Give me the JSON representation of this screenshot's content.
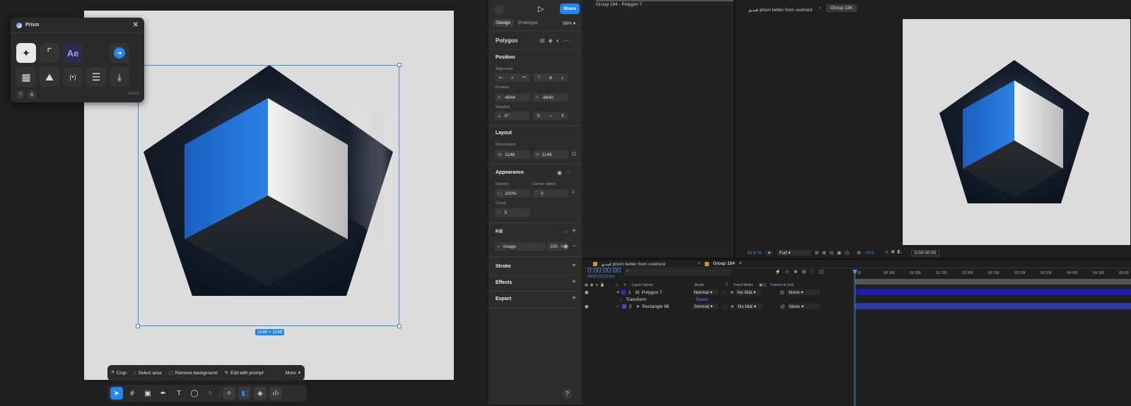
{
  "plugin": {
    "title": "Prism",
    "version": "v2.5.0",
    "ae_label": "Ae",
    "help": "?"
  },
  "canvas": {
    "size_badge": "1148 × 1148"
  },
  "context_bar": {
    "crop": "Crop",
    "select_area": "Select area",
    "remove_background": "Remove background",
    "edit_with_prompt": "Edit with prompt",
    "more": "More"
  },
  "main_toolbar": {
    "help": "?"
  },
  "header": {
    "share": "Share",
    "tabs": [
      "Design",
      "Prototype"
    ],
    "zoom": "58%"
  },
  "props": {
    "layer_name": "Polygon",
    "position_title": "Position",
    "alignment_label": "Alignment",
    "position_label": "Position",
    "x_prefix": "X",
    "x": "-4944",
    "y_prefix": "Y",
    "y": "-8840",
    "rotation_label": "Rotation",
    "rotation": "0°",
    "layout_title": "Layout",
    "dimensions_label": "Dimensions",
    "w_prefix": "W",
    "w": "1148",
    "h_prefix": "H",
    "h": "1148",
    "appearance_title": "Appearance",
    "opacity_label": "Opacity",
    "opacity": "100%",
    "corner_label": "Corner radius",
    "corner": "0",
    "count_label": "Count",
    "count": "5",
    "fill_title": "Fill",
    "fill_type": "Image",
    "fill_opacity": "100",
    "fill_percent": "%",
    "stroke_title": "Stroke",
    "effects_title": "Effects",
    "export_title": "Export"
  },
  "ae": {
    "project_breadcrumb": "Group 184 - Polygon 7",
    "viewer_tab_1": "فيديو prism better from overlord",
    "viewer_tab_2": "Group 184",
    "zoom": "32.8",
    "zoom_unit": "%",
    "resolution": "Full",
    "exposure": "+0.0",
    "viewer_time": "0:00:00:00",
    "timeline_tab_1": "فيديو prism better from overlord",
    "timeline_tab_2": "Group 184",
    "timecode": "0:00:00:00",
    "timecode_sub": "00000 (30.00 fps)",
    "search_placeholder": "",
    "columns": {
      "num": "#",
      "layer_name": "Layer Name",
      "mode": "Mode",
      "t": "T",
      "track_matte": "Track Matte",
      "parent": "Parent & Link"
    },
    "layers": [
      {
        "num": "1",
        "name": "Polygon 7",
        "mode": "Normal",
        "matte": "No Mat",
        "parent": "None",
        "color": "#2a2ad6"
      },
      {
        "num": "2",
        "name": "Rectangle 98",
        "mode": "Normal",
        "matte": "No Mat",
        "parent": "None",
        "color": "#3b4cc9"
      }
    ],
    "transform_label": "Transform",
    "reset_label": "Reset",
    "ruler": [
      "0f",
      "00:15f",
      "01:00f",
      "01:15f",
      "02:00f",
      "02:15f",
      "03:00f",
      "03:15f",
      "04:00f",
      "04:15f",
      "05:00"
    ]
  },
  "colors": {
    "accent_blue": "#1f86f2",
    "ae_timecode": "#4a8fe6",
    "layer_bar_1": "#1d1dab",
    "layer_bar_2": "#2e3a9e"
  }
}
